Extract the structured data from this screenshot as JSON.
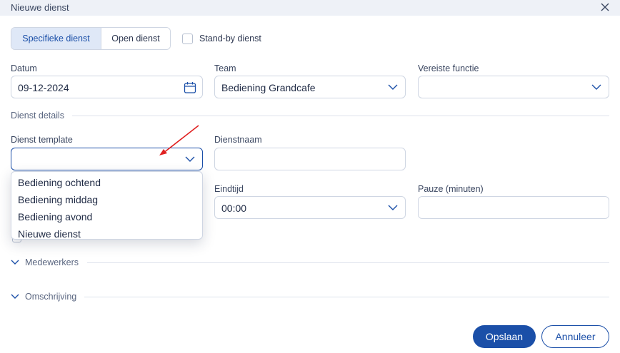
{
  "dialog": {
    "title": "Nieuwe dienst"
  },
  "type_toggle": {
    "specific": "Specifieke dienst",
    "open": "Open dienst"
  },
  "standby": {
    "label": "Stand-by dienst",
    "checked": false
  },
  "fields": {
    "datum": {
      "label": "Datum",
      "value": "09-12-2024"
    },
    "team": {
      "label": "Team",
      "value": "Bediening Grandcafe"
    },
    "functie": {
      "label": "Vereiste functie",
      "value": ""
    },
    "template": {
      "label": "Dienst template",
      "value": ""
    },
    "dienstnaam": {
      "label": "Dienstnaam",
      "value": ""
    },
    "eindtijd": {
      "label": "Eindtijd",
      "value": "00:00"
    },
    "pauze": {
      "label": "Pauze (minuten)",
      "value": ""
    }
  },
  "sections": {
    "details": "Dienst details",
    "medewerkers": "Medewerkers",
    "omschrijving": "Omschrijving"
  },
  "template_options": [
    "Bediening ochtend",
    "Bediening middag",
    "Bediening avond",
    "Nieuwe dienst"
  ],
  "actions": {
    "save": "Opslaan",
    "cancel": "Annuleer"
  },
  "colors": {
    "primary": "#1b4fa8",
    "annotation_arrow": "#e02020"
  }
}
